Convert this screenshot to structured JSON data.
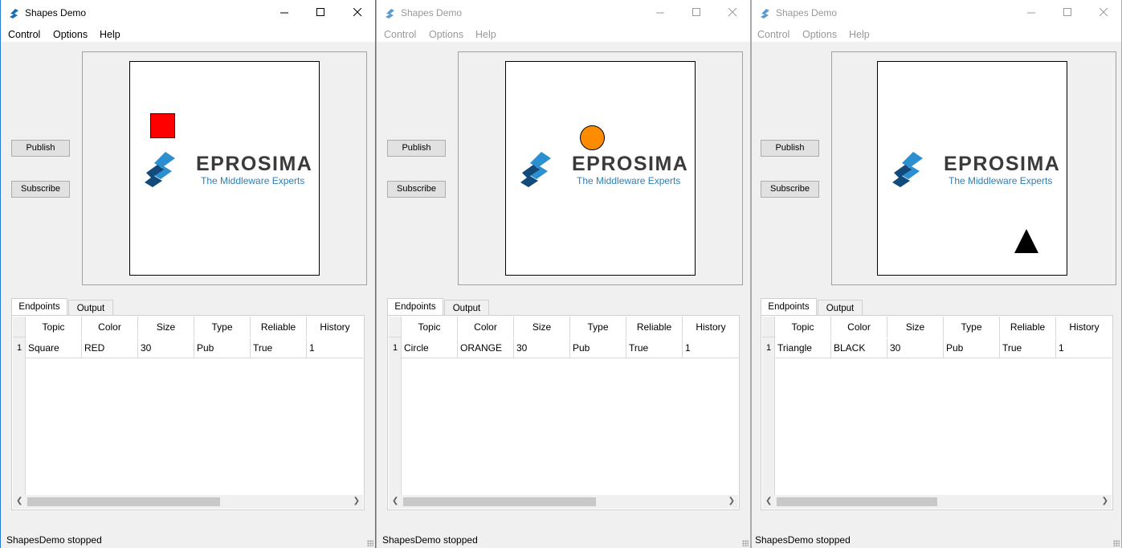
{
  "windows": [
    {
      "title": "Shapes Demo",
      "menu": [
        "Control",
        "Options",
        "Help"
      ],
      "publish_label": "Publish",
      "subscribe_label": "Subscribe",
      "logo_text": "EPROSIMA",
      "logo_subtitle": "The Middleware Experts",
      "tabs": [
        "Endpoints",
        "Output"
      ],
      "columns": [
        "Topic",
        "Color",
        "Size",
        "Type",
        "Reliable",
        "History"
      ],
      "row_number": "1",
      "row": [
        "Square",
        "RED",
        "30",
        "Pub",
        "True",
        "1"
      ],
      "status": "ShapesDemo stopped",
      "shape": {
        "kind": "square",
        "color": "#ff0000"
      }
    },
    {
      "title": "Shapes Demo",
      "menu": [
        "Control",
        "Options",
        "Help"
      ],
      "publish_label": "Publish",
      "subscribe_label": "Subscribe",
      "logo_text": "EPROSIMA",
      "logo_subtitle": "The Middleware Experts",
      "tabs": [
        "Endpoints",
        "Output"
      ],
      "columns": [
        "Topic",
        "Color",
        "Size",
        "Type",
        "Reliable",
        "History"
      ],
      "row_number": "1",
      "row": [
        "Circle",
        "ORANGE",
        "30",
        "Pub",
        "True",
        "1"
      ],
      "status": "ShapesDemo stopped",
      "shape": {
        "kind": "circle",
        "color": "#ff8c00"
      }
    },
    {
      "title": "Shapes Demo",
      "menu": [
        "Control",
        "Options",
        "Help"
      ],
      "publish_label": "Publish",
      "subscribe_label": "Subscribe",
      "logo_text": "EPROSIMA",
      "logo_subtitle": "The Middleware Experts",
      "tabs": [
        "Endpoints",
        "Output"
      ],
      "columns": [
        "Topic",
        "Color",
        "Size",
        "Type",
        "Reliable",
        "History"
      ],
      "row_number": "1",
      "row": [
        "Triangle",
        "BLACK",
        "30",
        "Pub",
        "True",
        "1"
      ],
      "status": "ShapesDemo stopped",
      "shape": {
        "kind": "triangle",
        "color": "#000000"
      }
    }
  ]
}
